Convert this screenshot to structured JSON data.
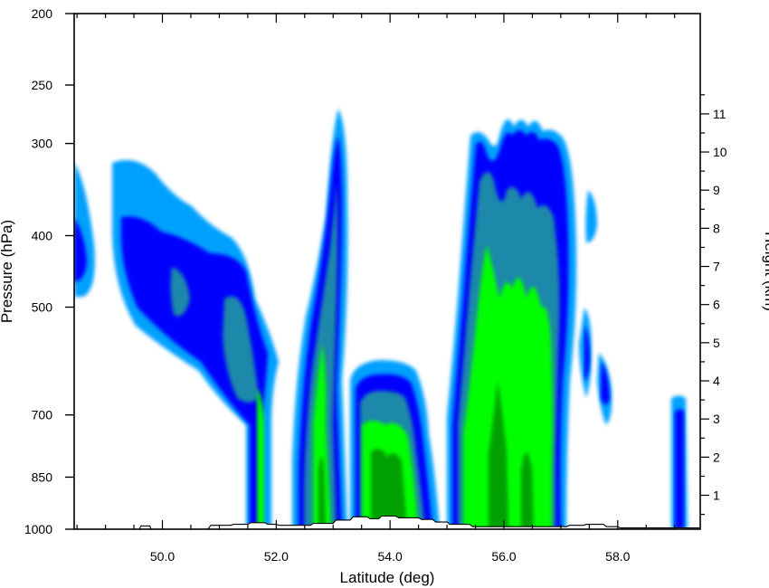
{
  "chart_data": {
    "type": "contour",
    "title": "",
    "xlabel": "Latitude (deg)",
    "ylabel": "Pressure (hPa)",
    "y2label": "Height (km)",
    "xlim": [
      48.45,
      59.45
    ],
    "ylim_pressure": [
      1000,
      200
    ],
    "y_scale": "log",
    "x_ticks": [
      "50.0",
      "52.0",
      "54.0",
      "56.0",
      "58.0"
    ],
    "x_tick_values": [
      50,
      52,
      54,
      56,
      58
    ],
    "y_ticks": [
      "200",
      "250",
      "300",
      "400",
      "500",
      "700",
      "850",
      "1000"
    ],
    "y_tick_values": [
      200,
      250,
      300,
      400,
      500,
      700,
      850,
      1000
    ],
    "y2_ticks": [
      "1",
      "2",
      "3",
      "4",
      "5",
      "6",
      "7",
      "8",
      "9",
      "10",
      "11"
    ],
    "y2_tick_values": [
      1,
      2,
      3,
      4,
      5,
      6,
      7,
      8,
      9,
      10,
      11
    ],
    "grid": false,
    "legend": "none",
    "levels": [
      {
        "level": 1,
        "color": "#00A0FF"
      },
      {
        "level": 2,
        "color": "#0000FF"
      },
      {
        "level": 3,
        "color": "#1E88AA"
      },
      {
        "level": 4,
        "color": "#00FF00"
      },
      {
        "level": 5,
        "color": "#00A000"
      }
    ],
    "terrain": {
      "color": "#ffffff",
      "outline": "#000000",
      "points": [
        [
          48.45,
          1000
        ],
        [
          49.6,
          1000
        ],
        [
          49.62,
          990
        ],
        [
          49.78,
          990
        ],
        [
          49.8,
          1000
        ],
        [
          50.8,
          1000
        ],
        [
          50.85,
          988
        ],
        [
          51.2,
          988
        ],
        [
          51.25,
          985
        ],
        [
          51.5,
          985
        ],
        [
          51.55,
          980
        ],
        [
          51.8,
          980
        ],
        [
          51.85,
          985
        ],
        [
          52.0,
          985
        ],
        [
          52.05,
          988
        ],
        [
          52.6,
          988
        ],
        [
          52.65,
          982
        ],
        [
          53.0,
          982
        ],
        [
          53.05,
          972
        ],
        [
          53.3,
          972
        ],
        [
          53.35,
          962
        ],
        [
          53.6,
          962
        ],
        [
          53.65,
          968
        ],
        [
          53.8,
          968
        ],
        [
          53.85,
          960
        ],
        [
          54.1,
          960
        ],
        [
          54.15,
          965
        ],
        [
          54.5,
          965
        ],
        [
          54.55,
          970
        ],
        [
          54.75,
          970
        ],
        [
          54.8,
          978
        ],
        [
          55.0,
          978
        ],
        [
          55.05,
          985
        ],
        [
          55.4,
          985
        ],
        [
          55.45,
          992
        ],
        [
          57.1,
          992
        ],
        [
          57.15,
          988
        ],
        [
          57.4,
          988
        ],
        [
          57.45,
          985
        ],
        [
          57.75,
          985
        ],
        [
          57.8,
          992
        ],
        [
          58.0,
          992
        ],
        [
          58.05,
          996
        ],
        [
          59.45,
          996
        ],
        [
          59.45,
          1000
        ]
      ]
    },
    "features": [
      {
        "name": "west-edge-cell",
        "lat": [
          48.45,
          48.85
        ],
        "p_top": 330,
        "p_bottom": 480
      },
      {
        "name": "frontal-anvil",
        "lat": [
          49.2,
          51.9
        ],
        "p_top": 320,
        "p_bottom": 1000
      },
      {
        "name": "tall-cell-53",
        "lat": [
          52.3,
          53.25
        ],
        "p_top": 275,
        "p_bottom": 1000
      },
      {
        "name": "shallow-cell-54",
        "lat": [
          53.6,
          54.9
        ],
        "p_top": 600,
        "p_bottom": 1000
      },
      {
        "name": "deep-cluster-56",
        "lat": [
          55.05,
          57.15
        ],
        "p_top": 275,
        "p_bottom": 1000
      },
      {
        "name": "cell-57-5",
        "lat": [
          57.4,
          57.9
        ],
        "p_top": 380,
        "p_bottom": 720
      },
      {
        "name": "cell-59",
        "lat": [
          58.9,
          59.25
        ],
        "p_top": 680,
        "p_bottom": 1000
      }
    ]
  }
}
